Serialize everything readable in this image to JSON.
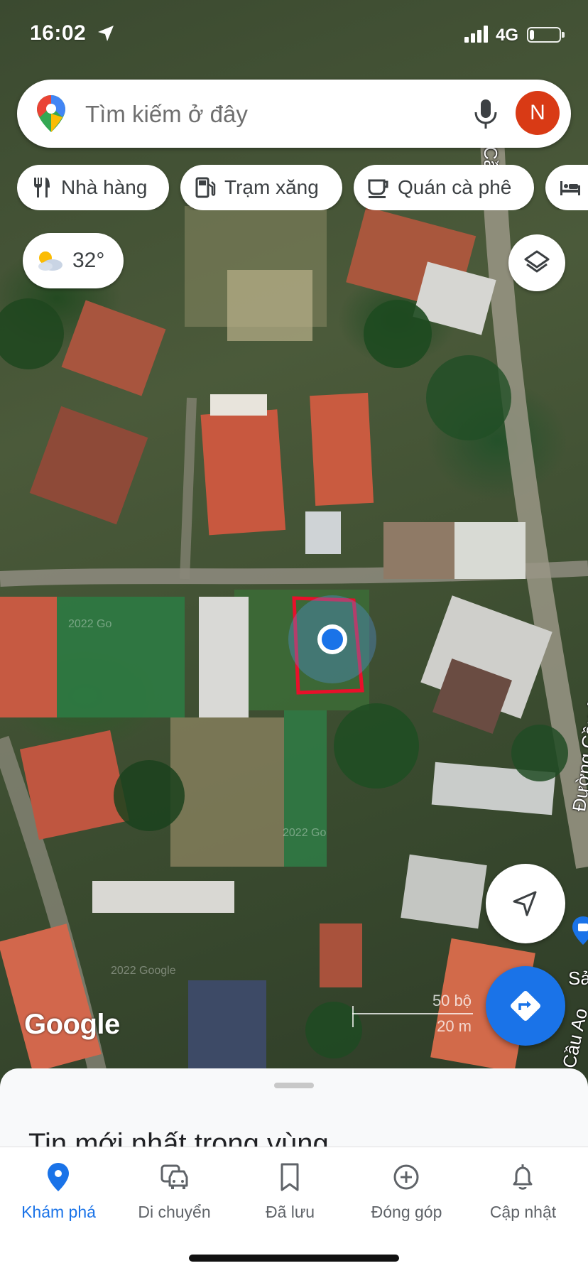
{
  "status_bar": {
    "time": "16:02",
    "network": "4G",
    "battery_level": 0.15
  },
  "search": {
    "placeholder": "Tìm kiếm ở đây",
    "avatar_letter": "N",
    "logo_icon": "google-maps-pin-icon",
    "mic_icon": "microphone-icon"
  },
  "chips": [
    {
      "label": "Nhà hàng",
      "icon": "restaurant-icon"
    },
    {
      "label": "Trạm xăng",
      "icon": "gas-station-icon"
    },
    {
      "label": "Quán cà phê",
      "icon": "coffee-cup-icon"
    },
    {
      "label": "",
      "icon": "hotel-bed-icon"
    }
  ],
  "weather": {
    "temperature": "32°",
    "icon": "partly-cloudy-icon"
  },
  "map": {
    "road_labels": {
      "top_right": "Cầu Ao",
      "right": "Đường Cầu Ao",
      "bottom_right": "Cầu Ao",
      "edge": "Sả"
    },
    "watermarks": [
      "2022 Go",
      "2022 Google",
      "2022 Go"
    ],
    "google_logo": "Google",
    "scale": {
      "imperial": "50 bộ",
      "metric": "20 m"
    },
    "current_location_marker": "blue-dot",
    "highlight_box_color": "#e8102a"
  },
  "buttons": {
    "layers_icon": "layers-icon",
    "locate_icon": "navigation-arrow-icon",
    "directions_icon": "directions-icon"
  },
  "sheet": {
    "heading": "Tin mới nhất trong vùng"
  },
  "nav": {
    "items": [
      {
        "label": "Khám phá",
        "icon": "explore-pin-icon",
        "active": true
      },
      {
        "label": "Di chuyển",
        "icon": "car-commute-icon",
        "active": false
      },
      {
        "label": "Đã lưu",
        "icon": "bookmark-icon",
        "active": false
      },
      {
        "label": "Đóng góp",
        "icon": "add-circle-icon",
        "active": false
      },
      {
        "label": "Cập nhật",
        "icon": "bell-icon",
        "active": false
      }
    ]
  },
  "colors": {
    "accent": "#1a73e8",
    "avatar": "#d93a15",
    "marker": "#1a73e8"
  }
}
